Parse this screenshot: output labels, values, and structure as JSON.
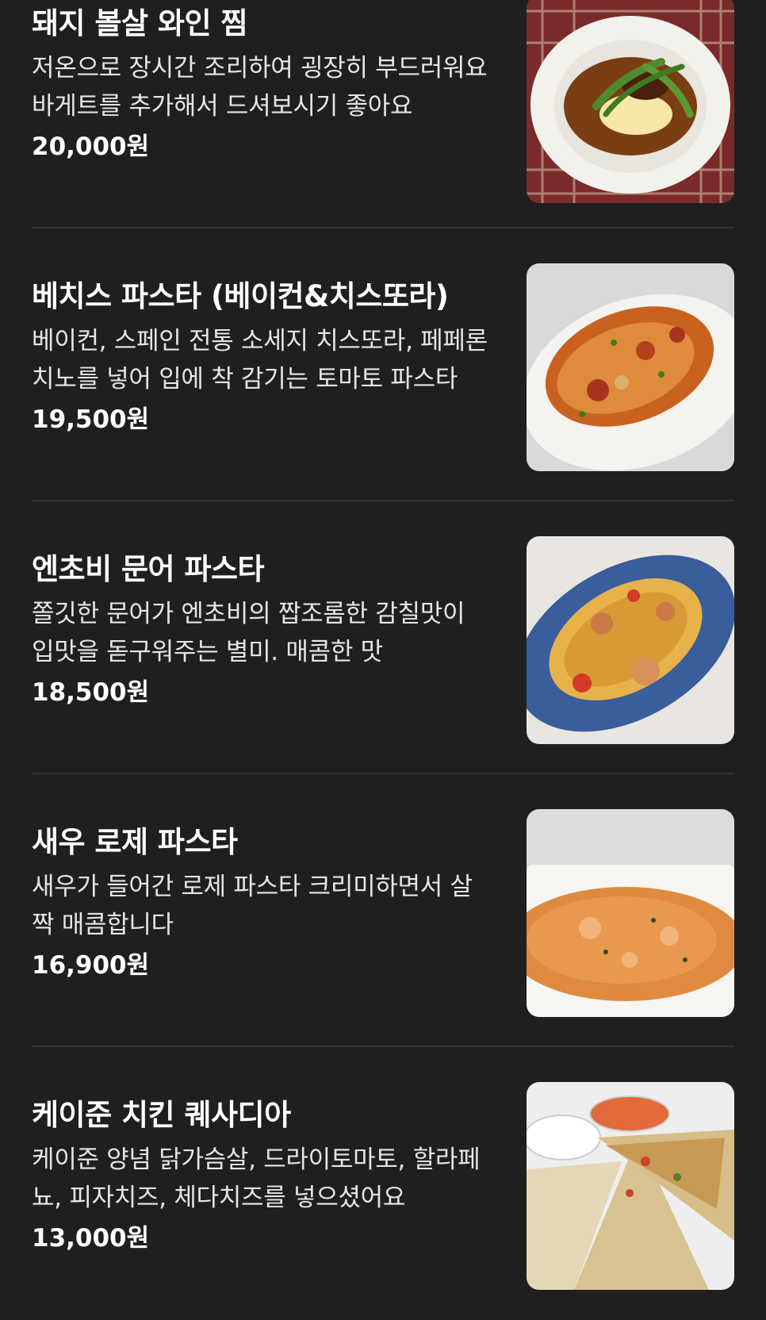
{
  "menu": {
    "items": [
      {
        "name": "돼지 볼살 와인 찜",
        "description": "저온으로 장시간 조리하여 굉장히 부드러워요 바게트를 추가해서 드셔보시기 좋아요",
        "price": "20,000원",
        "image_icon": "braised-pork-cheek-photo"
      },
      {
        "name": "베치스 파스타 (베이컨&치스또라)",
        "description": "베이컨, 스페인 전통 소세지 치스또라, 페페론치노를 넣어 입에 착 감기는 토마토 파스타",
        "price": "19,500원",
        "image_icon": "bacon-pasta-photo"
      },
      {
        "name": "엔초비 문어 파스타",
        "description": "쫄깃한 문어가 엔초비의 짭조롬한 감칠맛이 입맛을 돋구워주는 별미. 매콤한 맛",
        "price": "18,500원",
        "image_icon": "octopus-pasta-photo"
      },
      {
        "name": "새우 로제 파스타",
        "description": "새우가 들어간 로제 파스타 크리미하면서 살짝 매콤합니다",
        "price": "16,900원",
        "image_icon": "shrimp-rose-pasta-photo"
      },
      {
        "name": "케이준 치킨 퀘사디아",
        "description": "케이준 양념 닭가슴살, 드라이토마토, 할라페뇨, 피자치즈, 체다치즈를 넣으셨어요",
        "price": "13,000원",
        "image_icon": "quesadilla-photo"
      }
    ]
  }
}
